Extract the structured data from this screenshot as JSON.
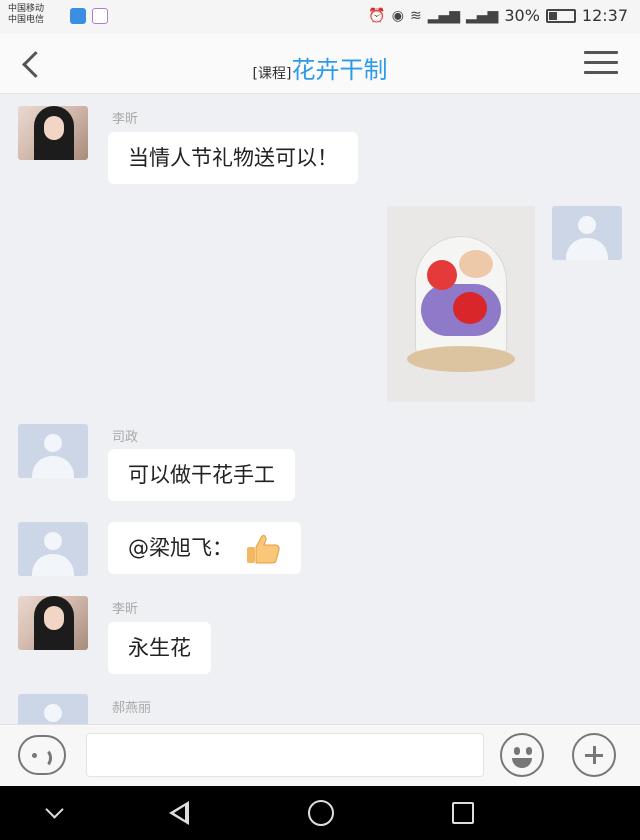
{
  "status_bar": {
    "carrier_1": "中国移动",
    "carrier_2": "中国电信",
    "battery": "30%",
    "time": "12:37",
    "icons": [
      "app-icon-blue",
      "app-icon-purple",
      "alarm-icon",
      "eye-icon",
      "wifi-icon",
      "signal-icon",
      "signal-icon",
      "battery-icon"
    ]
  },
  "header": {
    "tag": "[课程]",
    "title": "花卉干制",
    "back_icon": "chevron-left-icon",
    "menu_icon": "hamburger-menu-icon"
  },
  "messages": [
    {
      "sender": "李昕",
      "text": "当情人节礼物送可以！",
      "avatar": "photo"
    },
    {
      "sender": "",
      "text": "",
      "type": "image",
      "avatar": "default",
      "side": "right"
    },
    {
      "sender": "司政",
      "text": "可以做干花手工",
      "avatar": "default"
    },
    {
      "sender": "",
      "text": "@梁旭飞：",
      "emoji": "thumbs-up-icon",
      "avatar": "default"
    },
    {
      "sender": "李昕",
      "text": "永生花",
      "avatar": "photo"
    },
    {
      "sender": "郝燕丽",
      "text": "",
      "avatar": "default"
    }
  ],
  "input_bar": {
    "placeholder": "",
    "voice_icon": "voice-icon",
    "emoji_icon": "smiley-icon",
    "plus_icon": "plus-icon"
  },
  "nav_bar": {
    "icons": [
      "chevron-down-icon",
      "back-triangle-icon",
      "home-circle-icon",
      "recents-square-icon"
    ]
  },
  "colors": {
    "accent": "#2e9be8",
    "chat_bg": "#eef0f3",
    "bubble_bg": "#ffffff",
    "default_avatar": "#ccd6e6",
    "nav_bg": "#000000"
  }
}
